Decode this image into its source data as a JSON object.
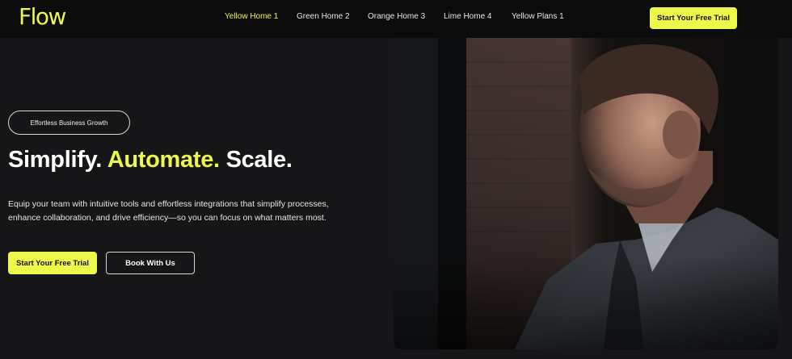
{
  "header": {
    "logo": "Flow",
    "nav": [
      {
        "label": "Yellow Home 1",
        "active": true
      },
      {
        "label": "Green Home 2",
        "active": false
      },
      {
        "label": "Orange Home 3",
        "active": false
      },
      {
        "label": "Lime Home 4",
        "active": false
      },
      {
        "label": "Yellow Plans 1",
        "active": false
      }
    ],
    "cta_label": "Start Your Free Trial"
  },
  "hero": {
    "badge": "Effortless Business Growth",
    "headline_part1": "Simplify.",
    "headline_highlight": "Automate.",
    "headline_part2": "Scale.",
    "description": "Equip your team with intuitive tools and effortless integrations that simplify processes, enhance collaboration, and drive efficiency—so you can focus on what matters most.",
    "primary_button": "Start Your Free Trial",
    "secondary_button": "Book With Us",
    "image_subject": "man-in-suit-photo"
  },
  "colors": {
    "accent": "#eef84a",
    "background": "#161618",
    "navbar": "#0b0b0c"
  }
}
